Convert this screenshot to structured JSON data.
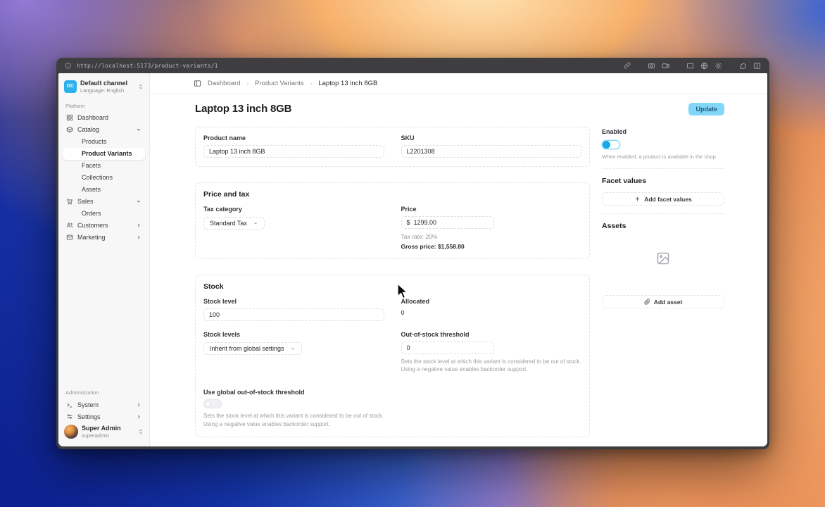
{
  "browser": {
    "url": "http://localhost:5173/product-variants/1"
  },
  "channel": {
    "initials": "DC",
    "name": "Default channel",
    "language": "Language: English"
  },
  "sidebar": {
    "platform_label": "Platform",
    "dashboard": "Dashboard",
    "catalog": "Catalog",
    "catalog_children": [
      "Products",
      "Product Variants",
      "Facets",
      "Collections",
      "Assets"
    ],
    "sales": "Sales",
    "sales_children": [
      "Orders"
    ],
    "customers": "Customers",
    "marketing": "Marketing",
    "administration_label": "Administration",
    "system": "System",
    "settings": "Settings"
  },
  "user": {
    "name": "Super Admin",
    "username": "superadmin"
  },
  "breadcrumb": {
    "items": [
      "Dashboard",
      "Product Variants",
      "Laptop 13 inch 8GB"
    ]
  },
  "page": {
    "title": "Laptop 13 inch 8GB",
    "update_button": "Update"
  },
  "details_card": {
    "product_name_label": "Product name",
    "product_name_value": "Laptop 13 inch 8GB",
    "sku_label": "SKU",
    "sku_value": "L2201308"
  },
  "price_card": {
    "title": "Price and tax",
    "tax_category_label": "Tax category",
    "tax_category_value": "Standard Tax",
    "price_label": "Price",
    "currency_symbol": "$",
    "price_value": "1299.00",
    "tax_rate_text": "Tax rate: 20%",
    "gross_price_text": "Gross price: $1,558.80"
  },
  "stock_card": {
    "title": "Stock",
    "stock_level_label": "Stock level",
    "stock_level_value": "100",
    "allocated_label": "Allocated",
    "allocated_value": "0",
    "stock_levels_label": "Stock levels",
    "stock_levels_value": "Inherit from global settings",
    "threshold_label": "Out-of-stock threshold",
    "threshold_value": "0",
    "threshold_help": "Sets the stock level at which this variant is considered to be out of stock. Using a negative value enables backorder support.",
    "global_threshold_label": "Use global out-of-stock threshold",
    "global_threshold_help": "Sets the stock level at which this variant is considered to be out of stock. Using a negative value enables backorder support."
  },
  "enabled_panel": {
    "label": "Enabled",
    "help": "When enabled, a product is available in the shop"
  },
  "facet_panel": {
    "title": "Facet values",
    "add_button": "Add facet values"
  },
  "assets_panel": {
    "title": "Assets",
    "add_button": "Add asset"
  },
  "colors": {
    "accent_button": "#82d6f8",
    "toggle_on": "#18a8e6",
    "channel_badge": "#2cb1ea"
  }
}
